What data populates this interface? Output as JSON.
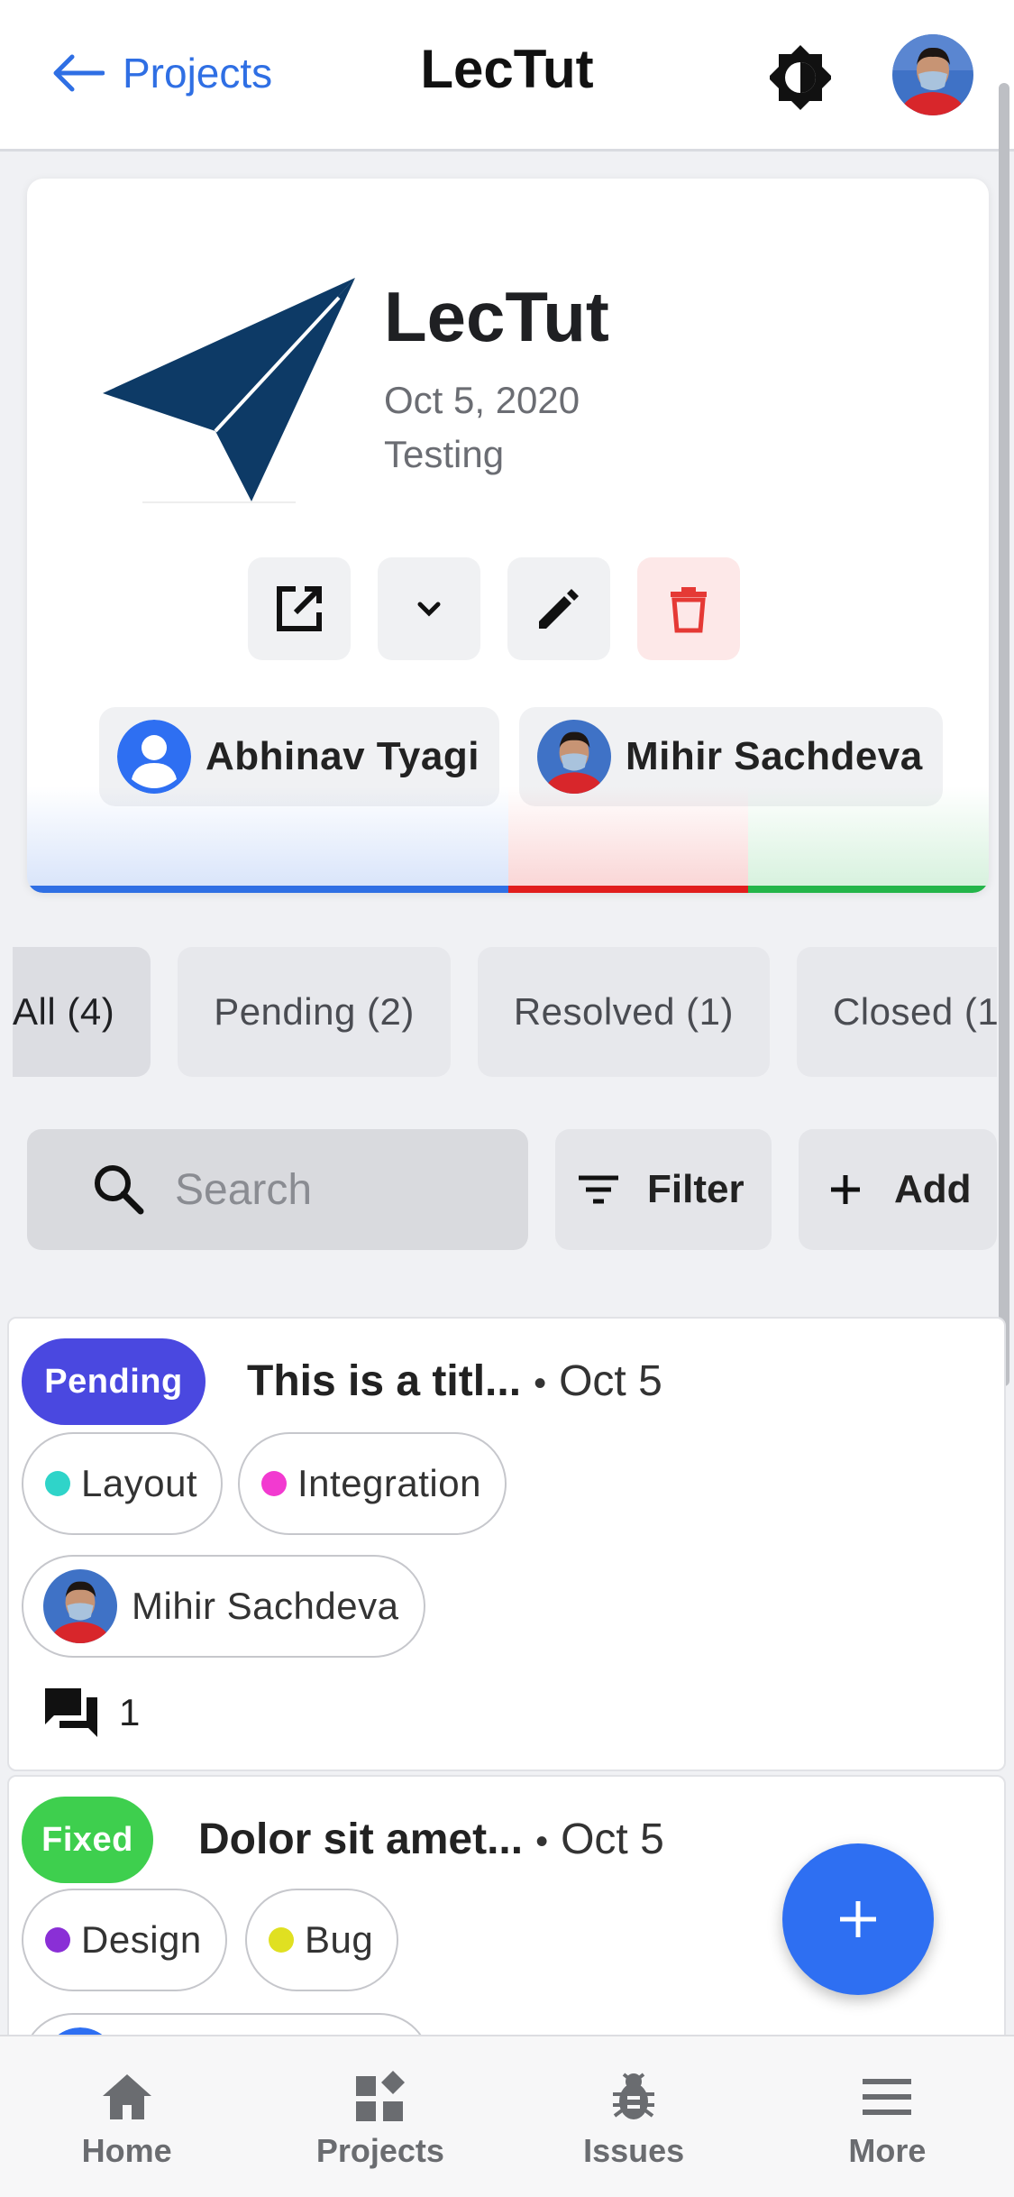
{
  "header": {
    "back_label": "Projects",
    "title": "LecTut",
    "theme_icon": "brightness-icon",
    "avatar_icon": "user-avatar"
  },
  "project": {
    "name": "LecTut",
    "date": "Oct 5, 2020",
    "status": "Testing",
    "logo_color": "#0d3a66",
    "actions": [
      {
        "name": "open-external-button",
        "icon": "open-in-new-icon"
      },
      {
        "name": "expand-button",
        "icon": "chevron-down-icon"
      },
      {
        "name": "edit-button",
        "icon": "pencil-icon"
      },
      {
        "name": "delete-button",
        "icon": "trash-icon",
        "color": "#e53935"
      }
    ],
    "members": [
      {
        "name": "Abhinav Tyagi",
        "avatar": "default-user-icon"
      },
      {
        "name": "Mihir Sachdeva",
        "avatar": "photo-avatar"
      }
    ],
    "progress": [
      {
        "status": "Pending",
        "share": 0.5,
        "color": "#2f6fe4"
      },
      {
        "status": "Resolved",
        "share": 0.25,
        "color": "#e11d1d"
      },
      {
        "status": "Closed",
        "share": 0.25,
        "color": "#24b54a"
      }
    ]
  },
  "tabs": [
    {
      "label": "All (4)",
      "active": true
    },
    {
      "label": "Pending (2)"
    },
    {
      "label": "Resolved (1)"
    },
    {
      "label": "Closed (1"
    }
  ],
  "toolbar": {
    "search_placeholder": "Search",
    "filter_label": "Filter",
    "add_label": "Add"
  },
  "issues": [
    {
      "status": "Pending",
      "status_color": "#4a48e0",
      "title": "This is a titl...",
      "date": "Oct 5",
      "labels": [
        {
          "name": "Layout",
          "color": "#2fd4c9"
        },
        {
          "name": "Integration",
          "color": "#f23ad0"
        }
      ],
      "assignee": "Mihir Sachdeva",
      "comments": "1"
    },
    {
      "status": "Fixed",
      "status_color": "#3ecf4e",
      "title": "Dolor sit amet...",
      "date": "Oct 5",
      "labels": [
        {
          "name": "Design",
          "color": "#8a2fd6"
        },
        {
          "name": "Bug",
          "color": "#e0e021"
        }
      ]
    }
  ],
  "nav": [
    {
      "label": "Home",
      "icon": "home-icon"
    },
    {
      "label": "Projects",
      "icon": "projects-icon"
    },
    {
      "label": "Issues",
      "icon": "bug-icon"
    },
    {
      "label": "More",
      "icon": "menu-icon"
    }
  ]
}
